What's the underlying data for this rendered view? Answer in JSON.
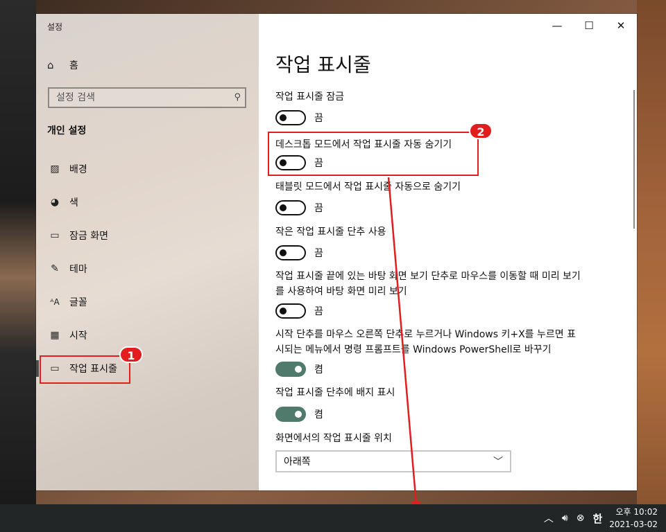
{
  "window": {
    "title": "설정",
    "controls": {
      "minimize": "—",
      "maximize": "☐",
      "close": "✕"
    }
  },
  "sidebar": {
    "home_label": "홈",
    "search_placeholder": "설정 검색",
    "section_heading": "개인 설정",
    "items": [
      {
        "label": "배경",
        "icon": "image-icon"
      },
      {
        "label": "색",
        "icon": "palette-icon"
      },
      {
        "label": "잠금 화면",
        "icon": "lock-screen-icon"
      },
      {
        "label": "테마",
        "icon": "theme-icon"
      },
      {
        "label": "글꼴",
        "icon": "font-icon"
      },
      {
        "label": "시작",
        "icon": "start-icon"
      },
      {
        "label": "작업 표시줄",
        "icon": "taskbar-icon",
        "selected": true
      }
    ]
  },
  "content": {
    "page_title": "작업 표시줄",
    "settings": [
      {
        "label": "작업 표시줄 잠금",
        "state": "끔",
        "on": false
      },
      {
        "label": "데스크톱 모드에서 작업 표시줄 자동 숨기기",
        "state": "끔",
        "on": false
      },
      {
        "label": "태블릿 모드에서 작업 표시줄 자동으로 숨기기",
        "state": "끔",
        "on": false
      },
      {
        "label": "작은 작업 표시줄 단추 사용",
        "state": "끔",
        "on": false
      },
      {
        "label": "작업 표시줄 끝에 있는 바탕 화면 보기 단추로 마우스를 이동할 때 미리 보기를 사용하여 바탕 화면 미리 보기",
        "state": "끔",
        "on": false
      },
      {
        "label": "시작 단추를 마우스 오른쪽 단추로 누르거나 Windows 키+X를 누르면 표시되는 메뉴에서 명령 프롬프트를 Windows PowerShell로 바꾸기",
        "state": "켬",
        "on": true
      },
      {
        "label": "작업 표시줄 단추에 배지 표시",
        "state": "켬",
        "on": true
      }
    ],
    "position_label": "화면에서의 작업 표시줄 위치",
    "position_value": "아래쪽"
  },
  "annotations": {
    "badge1": "1",
    "badge2": "2",
    "color": "#e21d1d"
  },
  "taskbar": {
    "tray_icons": [
      "chevron-up-icon",
      "volume-icon",
      "network-disconnected-icon"
    ],
    "ime": "한",
    "time": "오후 10:02",
    "date": "2021-03-02"
  },
  "colors": {
    "toggle_on": "#4f7a6c",
    "taskbar": "#232627"
  }
}
